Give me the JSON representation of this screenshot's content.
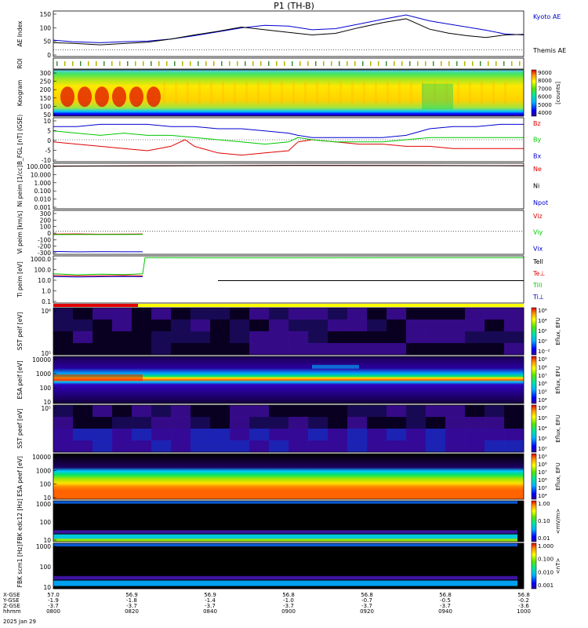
{
  "title": "P1 (TH-B)",
  "colors": {
    "red": "#e00000",
    "green": "#00c800",
    "blue": "#0000d0",
    "black": "#000000",
    "yellow": "#ffff00"
  },
  "chart_data": [
    {
      "type": "line",
      "ylabel": "AE Index",
      "ylim": [
        -25,
        150
      ],
      "yticks": [
        "150",
        "100",
        "50",
        "0"
      ],
      "legend": [
        "Kyoto AE",
        "Themis AE"
      ],
      "series": [
        {
          "name": "Kyoto AE",
          "color": "blue",
          "x": [
            0,
            0.04,
            0.1,
            0.15,
            0.2,
            0.25,
            0.3,
            0.35,
            0.4,
            0.45,
            0.5,
            0.55,
            0.6,
            0.65,
            0.7,
            0.75,
            0.8,
            0.84,
            0.88,
            0.92,
            0.96,
            1.0
          ],
          "values": [
            38,
            32,
            28,
            32,
            34,
            42,
            55,
            70,
            85,
            95,
            92,
            78,
            82,
            100,
            118,
            135,
            112,
            100,
            88,
            76,
            62,
            58
          ]
        },
        {
          "name": "Themis AE",
          "color": "black",
          "x": [
            0,
            0.04,
            0.1,
            0.15,
            0.2,
            0.25,
            0.3,
            0.35,
            0.4,
            0.45,
            0.5,
            0.55,
            0.6,
            0.65,
            0.7,
            0.75,
            0.8,
            0.84,
            0.88,
            0.92,
            0.96,
            1.0
          ],
          "values": [
            28,
            26,
            20,
            25,
            30,
            42,
            58,
            72,
            88,
            78,
            68,
            58,
            64,
            86,
            105,
            120,
            80,
            65,
            55,
            48,
            58,
            60
          ]
        }
      ]
    },
    {
      "type": "heatmap",
      "ylabel": "ROI",
      "yticks": []
    },
    {
      "type": "heatmap",
      "ylabel": "Keogram",
      "ylim": [
        50,
        300
      ],
      "yticks": [
        "300",
        "250",
        "200",
        "150",
        "100",
        "50"
      ],
      "colorbar": {
        "ticks": [
          "9000",
          "8000",
          "7000",
          "6000",
          "5000",
          "4000"
        ],
        "label": "[counts]"
      }
    },
    {
      "type": "line",
      "ylabel": "B_FGL [nT] (GSE)",
      "ylim": [
        -10,
        10
      ],
      "yticks": [
        "10",
        "5",
        "0",
        "-5",
        "-10"
      ],
      "legend": [
        "Bz",
        "By",
        "Bx"
      ],
      "series": [
        {
          "name": "Bz",
          "color": "red",
          "x": [
            0,
            0.05,
            0.1,
            0.15,
            0.2,
            0.25,
            0.28,
            0.3,
            0.35,
            0.4,
            0.45,
            0.5,
            0.52,
            0.55,
            0.6,
            0.65,
            0.7,
            0.75,
            0.8,
            0.85,
            0.9,
            0.95,
            1.0
          ],
          "values": [
            -1,
            -2,
            -3,
            -4,
            -5,
            -3,
            0,
            -3,
            -6,
            -7,
            -6,
            -5,
            -1,
            0,
            -1,
            -2,
            -2,
            -3,
            -3,
            -4,
            -4,
            -4,
            -4
          ]
        },
        {
          "name": "By",
          "color": "green",
          "x": [
            0,
            0.05,
            0.1,
            0.15,
            0.2,
            0.25,
            0.3,
            0.35,
            0.4,
            0.45,
            0.5,
            0.52,
            0.55,
            0.6,
            0.65,
            0.7,
            0.75,
            0.8,
            0.85,
            0.9,
            0.95,
            1.0
          ],
          "values": [
            4,
            3,
            2,
            3,
            2,
            2,
            1,
            0,
            -1,
            -2,
            -1,
            1,
            0,
            -1,
            -1,
            -1,
            0,
            1,
            1,
            1,
            1,
            1
          ]
        },
        {
          "name": "Bx",
          "color": "blue",
          "x": [
            0,
            0.05,
            0.1,
            0.15,
            0.2,
            0.25,
            0.3,
            0.35,
            0.4,
            0.45,
            0.5,
            0.52,
            0.55,
            0.6,
            0.65,
            0.7,
            0.75,
            0.8,
            0.85,
            0.9,
            0.95,
            1.0
          ],
          "values": [
            6,
            6,
            7,
            7,
            7,
            6,
            6,
            5,
            5,
            4,
            3,
            2,
            1,
            1,
            1,
            1,
            2,
            5,
            6,
            6,
            7,
            7
          ]
        }
      ]
    },
    {
      "type": "line",
      "log": true,
      "ylabel": "Ni peim [1/cc]",
      "ylim": [
        0.001,
        100
      ],
      "yticks": [
        "100.000",
        "10.000",
        "1.000",
        "0.100",
        "0.010",
        "0.001"
      ],
      "legend": [
        "Ne",
        "Ni",
        "Npot"
      ],
      "series": [
        {
          "name": "Ne",
          "color": "red",
          "x": [
            0,
            0.5,
            1.0
          ],
          "values": [
            50,
            60,
            55
          ]
        },
        {
          "name": "Ni",
          "color": "black",
          "x": [
            0,
            0.5,
            1.0
          ],
          "values": [
            48,
            58,
            53
          ]
        }
      ]
    },
    {
      "type": "line",
      "ylabel": "Vi peim [km/s]",
      "ylim": [
        -330,
        300
      ],
      "yticks": [
        "300",
        "200",
        "100",
        "0",
        "-100",
        "-200",
        "-300"
      ],
      "legend": [
        "Viz",
        "Viy",
        "Vix"
      ],
      "series": [
        {
          "name": "Viz",
          "color": "red",
          "x": [
            0,
            0.05,
            0.1,
            0.15,
            0.19
          ],
          "values": [
            -40,
            -38,
            -42,
            -40,
            -39
          ]
        },
        {
          "name": "Viy",
          "color": "green",
          "x": [
            0,
            0.05,
            0.1,
            0.15,
            0.19
          ],
          "values": [
            -48,
            -45,
            -47,
            -46,
            -44
          ]
        },
        {
          "name": "Vix",
          "color": "blue",
          "x": [
            0,
            0.05,
            0.1,
            0.15,
            0.19
          ],
          "values": [
            -290,
            -295,
            -292,
            -293,
            -294
          ]
        }
      ]
    },
    {
      "type": "line",
      "log": true,
      "ylabel": "Ti peim [eV]",
      "ylim": [
        0.1,
        1000
      ],
      "yticks": [
        "1000.0",
        "100.0",
        "10.0",
        "1.0",
        "0.1"
      ],
      "legend": [
        "Tell",
        "Te⊥",
        "Till",
        "Ti⊥"
      ],
      "series": [
        {
          "name": "Till",
          "color": "green",
          "x": [
            0,
            0.05,
            0.1,
            0.15,
            0.19,
            0.195,
            0.25,
            0.5,
            0.75,
            1.0
          ],
          "values": [
            30,
            25,
            28,
            26,
            30,
            700,
            700,
            690,
            700,
            700
          ]
        },
        {
          "name": "Te⊥",
          "color": "red",
          "x": [
            0,
            0.05,
            0.1,
            0.15,
            0.19
          ],
          "values": [
            22,
            20,
            21,
            22,
            21
          ]
        },
        {
          "name": "Ti⊥",
          "color": "blue",
          "x": [
            0,
            0.05,
            0.1,
            0.15,
            0.19
          ],
          "values": [
            18,
            16,
            17,
            18,
            17
          ]
        },
        {
          "name": "Tell",
          "color": "black",
          "x": [
            0.35,
            0.5,
            0.75,
            1.0
          ],
          "values": [
            8,
            8,
            8,
            8
          ]
        }
      ]
    },
    {
      "type": "heatmap",
      "ylabel": "SST peif [eV]",
      "yticks": [
        "10⁶",
        "10⁵"
      ],
      "colorbar": {
        "ticks": [
          "10⁶",
          "10⁴",
          "10²",
          "10⁰",
          "10⁻²"
        ],
        "label": "Eflux, EFU"
      }
    },
    {
      "type": "heatmap",
      "ylabel": "ESA peif [eV]",
      "yticks": [
        "10000",
        "1000",
        "100",
        "10"
      ],
      "colorbar": {
        "ticks": [
          "10⁹",
          "10⁸",
          "10⁷",
          "10⁶",
          "10⁵",
          "10⁴"
        ],
        "label": "Eflux, EFU"
      }
    },
    {
      "type": "heatmap",
      "ylabel": "SST peef [eV]",
      "yticks": [
        "10⁵"
      ],
      "colorbar": {
        "ticks": [
          "10⁸",
          "10⁶",
          "10⁴",
          "10²",
          "10⁰"
        ],
        "label": "Eflux, EFU"
      }
    },
    {
      "type": "heatmap",
      "ylabel": "ESA peef [eV]",
      "yticks": [
        "10000",
        "1000",
        "100",
        "10"
      ],
      "colorbar": {
        "ticks": [
          "10⁹",
          "10⁸",
          "10⁷",
          "10⁶",
          "10⁵",
          "10⁴"
        ],
        "label": "Eflux, EFU"
      }
    },
    {
      "type": "heatmap",
      "ylabel": "FBK edc12 [Hz]",
      "yticks": [
        "1000",
        "100",
        "10"
      ],
      "colorbar": {
        "ticks": [
          "1.00",
          "0.10",
          "0.01"
        ],
        "label": "<mV/m>"
      }
    },
    {
      "type": "heatmap",
      "ylabel": "FBK scm1 [Hz]",
      "yticks": [
        "1000",
        "100",
        "10"
      ],
      "colorbar": {
        "ticks": [
          "1.000",
          "0.100",
          "0.010",
          "0.001"
        ],
        "label": "<nT>"
      }
    }
  ],
  "xaxis": {
    "rows": [
      {
        "label": "X-GSE",
        "values": [
          "57.0",
          "56.9",
          "56.9",
          "56.8",
          "56.8",
          "56.8",
          "56.8"
        ]
      },
      {
        "label": "Y-GSE",
        "values": [
          "-1.9",
          "-1.8",
          "-1.4",
          "-1.0",
          "-0.7",
          "-0.5",
          "-0.2"
        ]
      },
      {
        "label": "Z-GSE",
        "values": [
          "-3.7",
          "-3.7",
          "-3.7",
          "-3.7",
          "-3.7",
          "-3.7",
          "-3.6"
        ]
      },
      {
        "label": "hhmm",
        "values": [
          "0800",
          "0820",
          "0840",
          "0900",
          "0920",
          "0940",
          "1000"
        ]
      }
    ],
    "date": "2025 Jan 29"
  }
}
